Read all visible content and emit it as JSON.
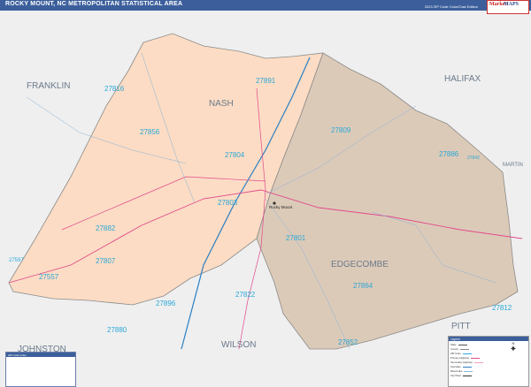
{
  "header": {
    "title": "ROCKY MOUNT, NC METROPOLITAN STATISTICAL AREA",
    "edition": "2023 ZIP Code Color/Cast Edition"
  },
  "logo": {
    "red": "Market",
    "blue": "MAPS"
  },
  "colors": {
    "nash": "#fcdcc4",
    "edgecombe": "#dccab8",
    "outside": "#efefef",
    "header": "#3c5f9c",
    "interstate": "#2a7fc4",
    "highway": "#e04a8c",
    "road": "#8ab4d8",
    "zip_label": "#2aa8d8",
    "county_label": "#6a7a8a"
  },
  "counties": {
    "franklin": "FRANKLIN",
    "nash": "NASH",
    "halifax": "HALIFAX",
    "martin": "MARTIN",
    "edgecombe": "EDGECOMBE",
    "pitt": "PITT",
    "wilson": "WILSON",
    "johnston": "JOHNSTON"
  },
  "city": "Rocky Mount",
  "zips": {
    "z27816": "27816",
    "z27891": "27891",
    "z27856": "27856",
    "z27809": "27809",
    "z27886": "27886",
    "z27804": "27804",
    "z27803": "27803",
    "z27882": "27882",
    "z27801": "27801",
    "z27807": "27807",
    "z27557": "27557",
    "z27597": "27597",
    "z27864": "27864",
    "z27822": "27822",
    "z27896": "27896",
    "z27880": "27880",
    "z27852": "27852",
    "z27812": "27812",
    "z27842": "27842"
  },
  "legend": {
    "title": "Legend",
    "rows": [
      "State",
      "County",
      "ZIP Code",
      "Primary Highway",
      "Secondary Highway",
      "Interstate",
      "River/Lake",
      "City/Town"
    ]
  },
  "index": {
    "title": "ZIP Code Index"
  },
  "compass": "N"
}
